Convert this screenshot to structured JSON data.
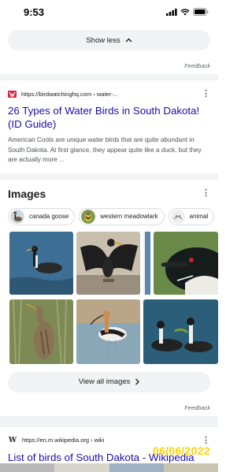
{
  "status_bar": {
    "time": "9:53"
  },
  "show_less": {
    "label": "Show less"
  },
  "feedback_label": "Feedback",
  "result1": {
    "url": "https://birdwatchinghq.com › water-...",
    "title": "26 Types of Water Birds in South Dakota! (ID Guide)",
    "snippet": "American Coots are unique water birds that are quite abundant in South Dakota. At first glance, they appear quite like a duck, but they are actually more ..."
  },
  "images": {
    "heading": "Images",
    "chips": [
      {
        "label": "canada goose",
        "icon": "canada-goose-thumb"
      },
      {
        "label": "western meadowlark",
        "icon": "meadowlark-thumb"
      },
      {
        "label": "animal",
        "icon": "animal-thumb"
      }
    ],
    "view_all": "View all images"
  },
  "result2": {
    "favicon": "W",
    "url": "https://en.m.wikipedia.org › wiki",
    "title": "List of birds of South Dakota - Wikipedia"
  },
  "watermark": "06/06/2022",
  "colors": {
    "link": "#1a0dab",
    "chip_border": "#dadce0",
    "pill_bg": "#f1f3f4",
    "watermark": "#ffd400"
  }
}
